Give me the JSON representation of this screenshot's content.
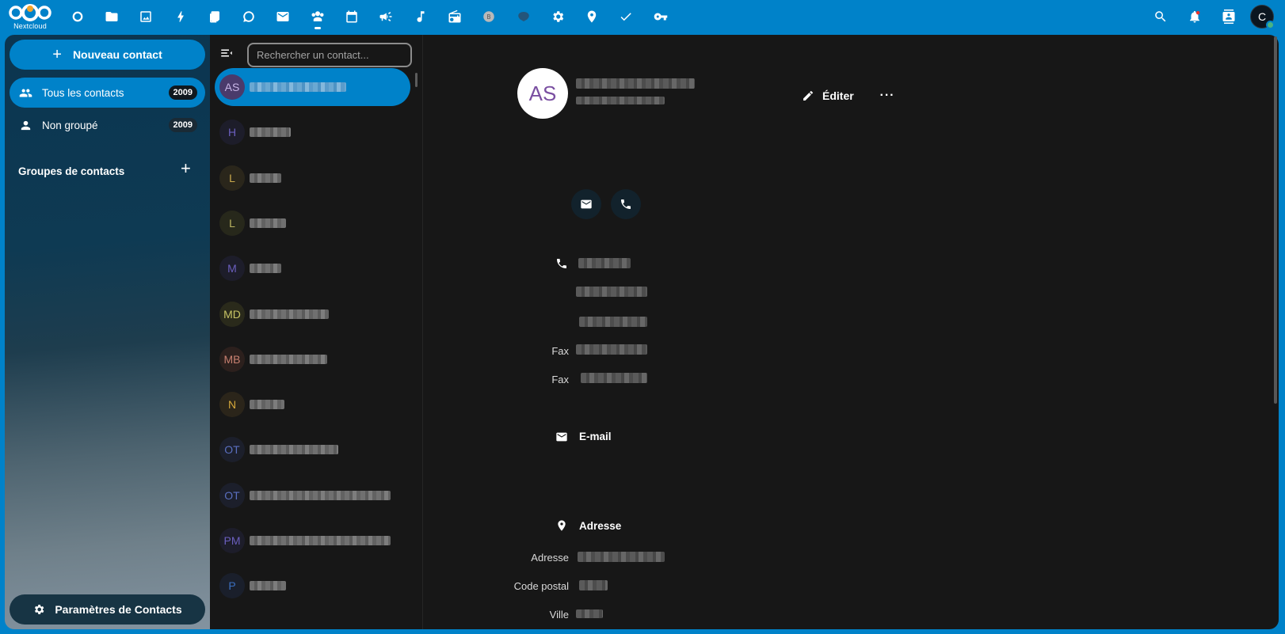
{
  "header": {
    "logo_text": "Nextcloud",
    "apps": [
      {
        "name": "dashboard-icon"
      },
      {
        "name": "files-icon"
      },
      {
        "name": "photos-icon"
      },
      {
        "name": "activity-icon"
      },
      {
        "name": "deck-icon"
      },
      {
        "name": "talk-icon"
      },
      {
        "name": "mail-icon"
      },
      {
        "name": "contacts-icon",
        "active": true
      },
      {
        "name": "calendar-icon"
      },
      {
        "name": "announcements-icon"
      },
      {
        "name": "music-icon"
      },
      {
        "name": "radio-icon"
      },
      {
        "name": "bookmarks-icon"
      },
      {
        "name": "forms-icon"
      },
      {
        "name": "settings-icon"
      },
      {
        "name": "maps-icon"
      },
      {
        "name": "tasks-icon"
      },
      {
        "name": "passwords-icon"
      }
    ],
    "user_initial": "C"
  },
  "sidebar": {
    "new_contact_label": "Nouveau contact",
    "all_contacts_label": "Tous les contacts",
    "all_contacts_count": "2009",
    "ungrouped_label": "Non groupé",
    "ungrouped_count": "2009",
    "groups_title": "Groupes de contacts",
    "settings_label": "Paramètres de Contacts"
  },
  "list": {
    "search_placeholder": "Rechercher un contact...",
    "contacts": [
      {
        "initials": "AS",
        "color": "#7a4fa1",
        "bg": "#ffffff"
      },
      {
        "initials": "H",
        "color": "#6b5fbf",
        "bg": "#1d1d2a"
      },
      {
        "initials": "L",
        "color": "#c9a94c",
        "bg": "#2a261b"
      },
      {
        "initials": "L",
        "color": "#b9b360",
        "bg": "#27281b"
      },
      {
        "initials": "M",
        "color": "#6b5fbf",
        "bg": "#1d1d2a"
      },
      {
        "initials": "MD",
        "color": "#c8c465",
        "bg": "#2a2a1b"
      },
      {
        "initials": "MB",
        "color": "#c88070",
        "bg": "#2c201d"
      },
      {
        "initials": "N",
        "color": "#d6a83a",
        "bg": "#2b251a"
      },
      {
        "initials": "OT",
        "color": "#5a6fbf",
        "bg": "#1c1f2b"
      },
      {
        "initials": "OT",
        "color": "#5a6fbf",
        "bg": "#1c1f2b"
      },
      {
        "initials": "PM",
        "color": "#6b5fbf",
        "bg": "#1d1d2a"
      },
      {
        "initials": "P",
        "color": "#3b6fbf",
        "bg": "#1a1f2b"
      }
    ]
  },
  "details": {
    "avatar_initials": "AS",
    "edit_label": "Éditer",
    "more_label": "···",
    "fax_label": "Fax",
    "email_title": "E-mail",
    "address_title": "Adresse",
    "address_label": "Adresse",
    "postal_code_label": "Code postal",
    "city_label": "Ville"
  }
}
